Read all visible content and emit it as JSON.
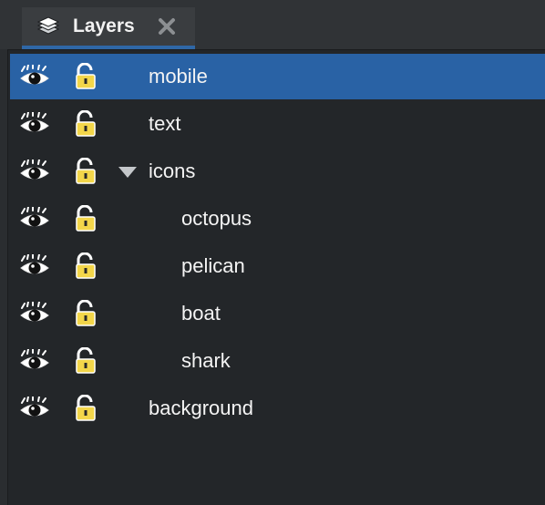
{
  "panel": {
    "tab": {
      "label": "Layers",
      "icon": "layers-stack-icon",
      "close_icon": "close-x-icon"
    },
    "accent_color": "#2962a5",
    "lock_color": "#f3d64a",
    "layers": [
      {
        "name": "mobile",
        "visible": true,
        "locked": false,
        "selected": true,
        "depth": 0,
        "expandable": false
      },
      {
        "name": "text",
        "visible": true,
        "locked": false,
        "selected": false,
        "depth": 0,
        "expandable": false
      },
      {
        "name": "icons",
        "visible": true,
        "locked": false,
        "selected": false,
        "depth": 0,
        "expandable": true,
        "expanded": true
      },
      {
        "name": "octopus",
        "visible": true,
        "locked": false,
        "selected": false,
        "depth": 1,
        "expandable": false
      },
      {
        "name": "pelican",
        "visible": true,
        "locked": false,
        "selected": false,
        "depth": 1,
        "expandable": false
      },
      {
        "name": "boat",
        "visible": true,
        "locked": false,
        "selected": false,
        "depth": 1,
        "expandable": false
      },
      {
        "name": "shark",
        "visible": true,
        "locked": false,
        "selected": false,
        "depth": 1,
        "expandable": false
      },
      {
        "name": "background",
        "visible": true,
        "locked": false,
        "selected": false,
        "depth": 0,
        "expandable": false
      }
    ]
  }
}
